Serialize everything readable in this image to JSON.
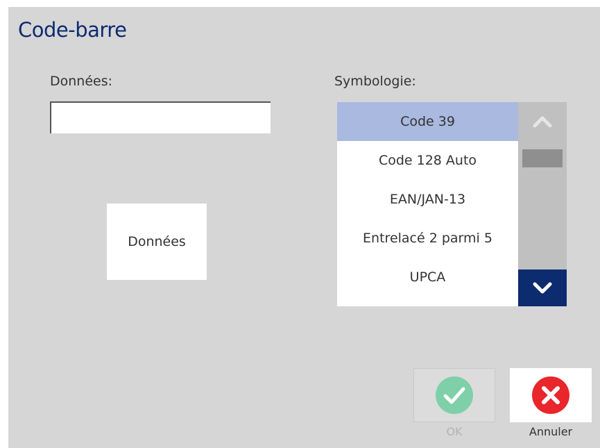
{
  "dialog": {
    "title": "Code-barre"
  },
  "data_field": {
    "label": "Données:",
    "value": "",
    "placeholder": ""
  },
  "data_button": {
    "label": "Données"
  },
  "symbology": {
    "label": "Symbologie:",
    "selected": "Code 39",
    "items": [
      {
        "label": "Code 39",
        "selected": true
      },
      {
        "label": "Code 128 Auto",
        "selected": false
      },
      {
        "label": "EAN/JAN-13",
        "selected": false
      },
      {
        "label": "Entrelacé 2 parmi 5",
        "selected": false
      },
      {
        "label": "UPCA",
        "selected": false
      }
    ],
    "scroll_up_icon": "chevron-up-icon",
    "scroll_down_icon": "chevron-down-icon"
  },
  "actions": {
    "ok_label": "OK",
    "ok_enabled": false,
    "ok_icon": "check-circle-icon",
    "cancel_label": "Annuler",
    "cancel_icon": "x-circle-icon"
  },
  "colors": {
    "title": "#0d2b6f",
    "background": "#d6d6d6",
    "selected_item": "#a9b9e0",
    "scroll_down_button": "#0d2b6f",
    "ok_icon": "#7fd0a8",
    "cancel_icon": "#e8262b"
  }
}
